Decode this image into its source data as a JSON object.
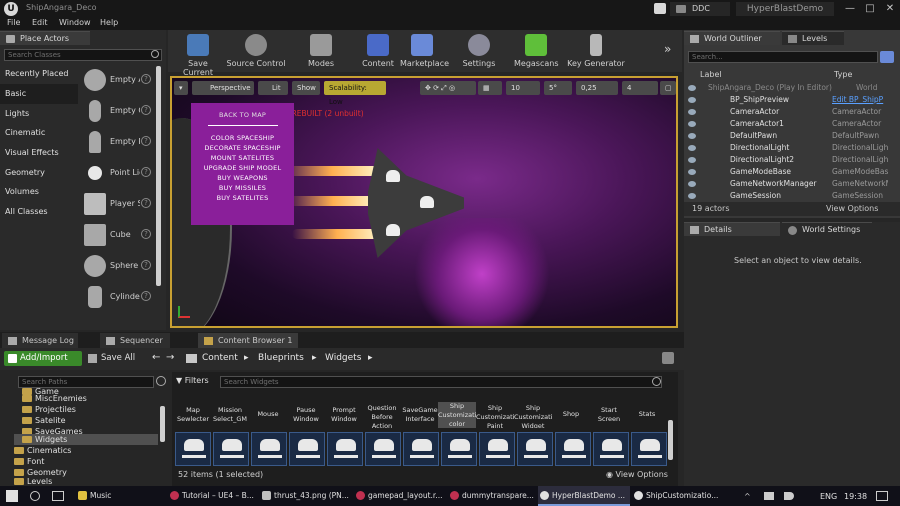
{
  "window": {
    "title": "ShipAngara_Deco",
    "ddc": "DDC",
    "project": "HyperBlastDemo",
    "minimize": "—",
    "maximize": "□",
    "close": "✕"
  },
  "menu": [
    "File",
    "Edit",
    "Window",
    "Help"
  ],
  "place_actors": {
    "tab": "Place Actors",
    "search_placeholder": "Search Classes",
    "categories": [
      "Recently Placed",
      "Basic",
      "Lights",
      "Cinematic",
      "Visual Effects",
      "Geometry",
      "Volumes",
      "All Classes"
    ],
    "selected_category": "Basic",
    "actors": [
      "Empty Actor",
      "Empty Character",
      "Empty Pawn",
      "Point Light",
      "Player Start",
      "Cube",
      "Sphere",
      "Cylinder"
    ],
    "help": "?"
  },
  "toolbar": {
    "buttons": [
      "Save Current",
      "Source Control",
      "Modes",
      "Content",
      "Marketplace",
      "Settings",
      "Megascans",
      "Key Generator"
    ],
    "more": "»"
  },
  "viewport": {
    "perspective": "Perspective",
    "lit": "Lit",
    "show": "Show",
    "scalability": "Scalability: Low",
    "snap_grid": "10",
    "snap_angle": "5°",
    "snap_scale": "0,25",
    "camera_speed": "4",
    "lighting_warning": "LIGHTING NEEDS TO BE REBUILT (2 unbuilt)",
    "game_menu": {
      "header": "BACK TO MAP",
      "items": [
        "COLOR SPACESHIP",
        "DECORATE SPACESHIP",
        "MOUNT SATELITES",
        "UPGRADE SHIP MODEL",
        "BUY WEAPONS",
        "BUY MISSILES",
        "BUY SATELITES"
      ]
    }
  },
  "outliner": {
    "tab_outliner": "World Outliner",
    "tab_levels": "Levels",
    "search_placeholder": "Search...",
    "col_label": "Label",
    "col_type": "Type",
    "root": "ShipAngara_Deco (Play In Editor)",
    "root_type": "World",
    "rows": [
      {
        "name": "BP_ShipPreview",
        "type": "Edit BP_ShipP"
      },
      {
        "name": "CameraActor",
        "type": "CameraActor"
      },
      {
        "name": "CameraActor1",
        "type": "CameraActor"
      },
      {
        "name": "DefaultPawn",
        "type": "DefaultPawn"
      },
      {
        "name": "DirectionalLight",
        "type": "DirectionalLigh"
      },
      {
        "name": "DirectionalLight2",
        "type": "DirectionalLigh"
      },
      {
        "name": "GameModeBase",
        "type": "GameModeBase"
      },
      {
        "name": "GameNetworkManager",
        "type": "GameNetworkM"
      },
      {
        "name": "GameSession",
        "type": "GameSession"
      }
    ],
    "count": "19 actors",
    "view_options": "View Options"
  },
  "details": {
    "tab_details": "Details",
    "tab_world": "World Settings",
    "empty": "Select an object to view details."
  },
  "bottom_tabs": [
    "Message Log",
    "Sequencer",
    "Content Browser 1"
  ],
  "content_browser": {
    "add_import": "Add/Import",
    "save_all": "Save All",
    "breadcrumb": [
      "Content",
      "Blueprints",
      "Widgets"
    ],
    "search_paths": "Search Paths",
    "filters": "Filters",
    "search_widgets": "Search Widgets",
    "folders": [
      {
        "name": "Game",
        "indent": 1
      },
      {
        "name": "MiscEnemies",
        "indent": 1
      },
      {
        "name": "Projectiles",
        "indent": 1
      },
      {
        "name": "Satelite",
        "indent": 1
      },
      {
        "name": "SaveGames",
        "indent": 1
      },
      {
        "name": "Widgets",
        "indent": 1
      },
      {
        "name": "Cinematics",
        "indent": 0
      },
      {
        "name": "Font",
        "indent": 0
      },
      {
        "name": "Geometry",
        "indent": 0
      },
      {
        "name": "Levels",
        "indent": 0
      }
    ],
    "assets_row1": [
      "Map Sewlecter",
      "Mission Select_GM",
      "Mouse",
      "Pause Window",
      "Prompt Window",
      "Question Before Action",
      "SaveGame Interface",
      "Ship Customization color",
      "Ship Customization Paint",
      "Ship Customization Widget",
      "Shop",
      "Start Screen",
      "Stats"
    ],
    "count": "52 items (1 selected)",
    "view_options": "View Options"
  },
  "taskbar": {
    "items": [
      "Music",
      "Tutorial – UE4 – B...",
      "thrust_43.png (PN...",
      "gamepad_layout.r...",
      "dummytranspare...",
      "HyperBlastDemo ...",
      "ShipCustomizatio..."
    ],
    "active": "HyperBlastDemo ...",
    "lang": "ENG",
    "time": "19:38"
  }
}
